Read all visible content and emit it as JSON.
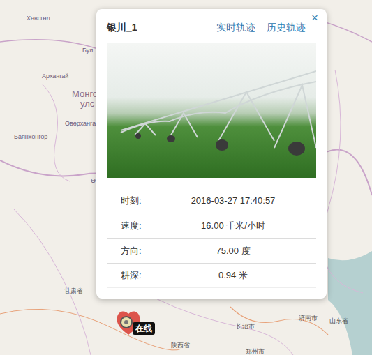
{
  "map": {
    "labels": [
      {
        "text": "Хөвсгөл"
      },
      {
        "text": "Бул"
      },
      {
        "text": "Архангай"
      },
      {
        "text": "Монго"
      },
      {
        "text": "улс"
      },
      {
        "text": "Өвөрханга"
      },
      {
        "text": "Баянхонгор"
      },
      {
        "text": "Ө"
      },
      {
        "text": "甘肃省"
      },
      {
        "text": "陕西省"
      },
      {
        "text": "长治市"
      },
      {
        "text": "济南市"
      },
      {
        "text": "山东省"
      },
      {
        "text": "郑州市"
      }
    ]
  },
  "popup": {
    "title": "银川_1",
    "links": [
      "实时轨迹",
      "历史轨迹"
    ],
    "close": "×",
    "rows": [
      {
        "label": "时刻:",
        "value": "2016-03-27 17:40:57"
      },
      {
        "label": "速度:",
        "value": "16.00 千米/小时"
      },
      {
        "label": "方向:",
        "value": "75.00 度"
      },
      {
        "label": "耕深:",
        "value": "0.94 米"
      }
    ]
  },
  "marker": {
    "status": "在线"
  }
}
